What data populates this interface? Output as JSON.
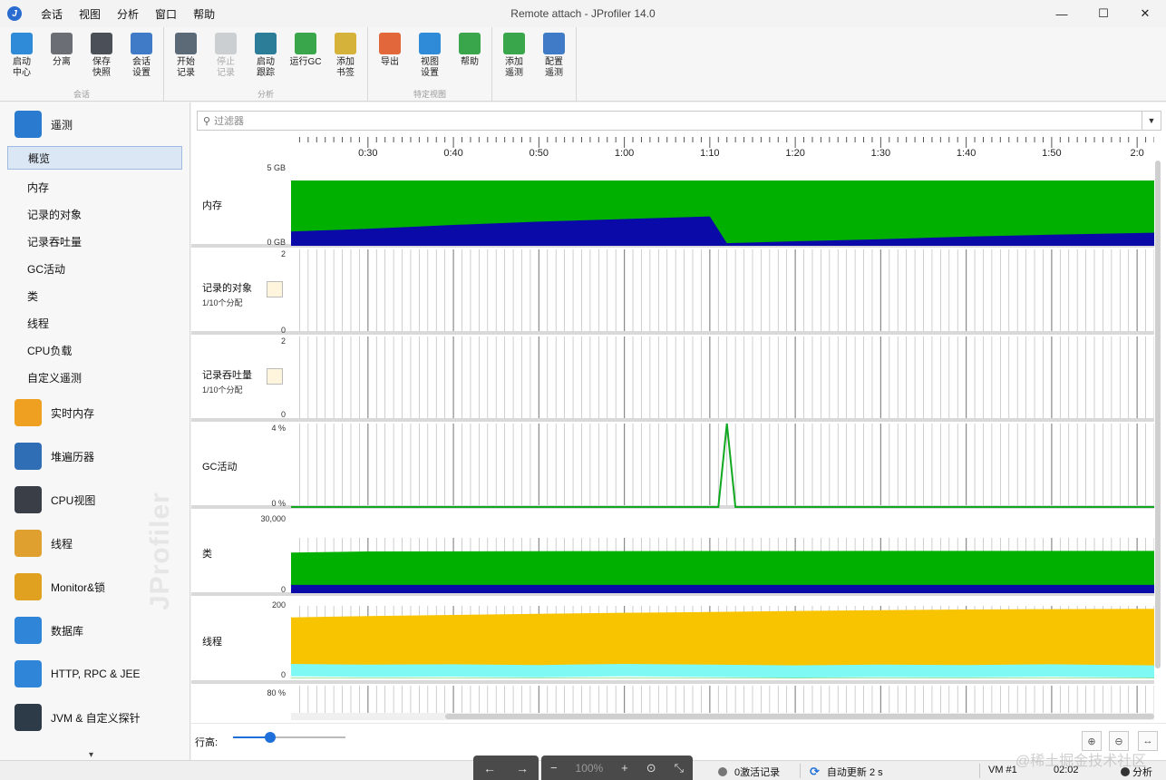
{
  "window": {
    "title": "Remote attach - JProfiler 14.0",
    "app_icon_glyph": "J",
    "minimize_glyph": "—",
    "maximize_glyph": "☐",
    "close_glyph": "✕"
  },
  "menu": [
    "会话",
    "视图",
    "分析",
    "窗口",
    "帮助"
  ],
  "toolbar": {
    "groups": [
      {
        "name": "会话",
        "buttons": [
          {
            "label": "启动\n中心",
            "icon": "start-center-icon",
            "color": "#2f8ad8"
          },
          {
            "label": "分离",
            "icon": "detach-icon",
            "color": "#6b6f75"
          },
          {
            "label": "保存\n快照",
            "icon": "save-snapshot-icon",
            "color": "#4a4f58"
          },
          {
            "label": "会话\n设置",
            "icon": "session-settings-icon",
            "color": "#3f7bc7"
          }
        ]
      },
      {
        "name": "分析",
        "buttons": [
          {
            "label": "开始\n记录",
            "icon": "start-recording-icon",
            "color": "#5c6a78"
          },
          {
            "label": "停止\n记录",
            "icon": "stop-recording-icon",
            "color": "#9aa0a6",
            "disabled": true
          },
          {
            "label": "启动\n跟踪",
            "icon": "start-tracking-icon",
            "color": "#2c7d97"
          },
          {
            "label": "运行GC",
            "icon": "run-gc-icon",
            "color": "#3aa64b"
          },
          {
            "label": "添加\n书签",
            "icon": "add-bookmark-icon",
            "color": "#d5b23a"
          }
        ]
      },
      {
        "name": "特定视图",
        "buttons": [
          {
            "label": "导出",
            "icon": "export-icon",
            "color": "#e2673a"
          },
          {
            "label": "视图\n设置",
            "icon": "view-settings-icon",
            "color": "#2f8ad8"
          },
          {
            "label": "帮助",
            "icon": "help-icon",
            "color": "#3aa64b"
          }
        ]
      },
      {
        "name": "",
        "buttons": [
          {
            "label": "添加\n遥测",
            "icon": "add-telemetry-icon",
            "color": "#3aa64b"
          },
          {
            "label": "配置\n遥测",
            "icon": "configure-telemetry-icon",
            "color": "#3f7bc7"
          }
        ]
      }
    ]
  },
  "sidebar": {
    "telemetry_section": {
      "label": "遥测",
      "icon": "telemetry-icon",
      "color": "#2a7bd0"
    },
    "telemetry_items": [
      "概览",
      "内存",
      "记录的对象",
      "记录吞吐量",
      "GC活动",
      "类",
      "线程",
      "CPU负载",
      "自定义遥测"
    ],
    "active_item": "概览",
    "sections": [
      {
        "label": "实时内存",
        "icon": "live-memory-icon",
        "color": "#f0a020"
      },
      {
        "label": "堆遍历器",
        "icon": "heap-walker-icon",
        "color": "#2f6db5"
      },
      {
        "label": "CPU视图",
        "icon": "cpu-views-icon",
        "color": "#3a3f47"
      },
      {
        "label": "线程",
        "icon": "threads-icon",
        "color": "#e0a030"
      },
      {
        "label": "Monitor&锁",
        "icon": "monitor-lock-icon",
        "color": "#e0a020"
      },
      {
        "label": "数据库",
        "icon": "database-icon",
        "color": "#2f86d8"
      },
      {
        "label": "HTTP, RPC & JEE",
        "icon": "globe-icon",
        "color": "#2f86d8"
      },
      {
        "label": "JVM & 自定义探针",
        "icon": "probe-gauge-icon",
        "color": "#2d3a48"
      }
    ],
    "watermark": "JProfiler",
    "scroll_more_glyph": "▾"
  },
  "filter": {
    "placeholder": "过滤器",
    "search_glyph": "⚲",
    "dropdown_glyph": "▼"
  },
  "timeline": {
    "ticks": [
      "0:30",
      "0:40",
      "0:50",
      "1:00",
      "1:10",
      "1:20",
      "1:30",
      "1:40",
      "1:50",
      "2:0"
    ]
  },
  "rows": [
    {
      "id": "memory",
      "label": "内存",
      "ymax": "5 GB",
      "ymin": "0 GB"
    },
    {
      "id": "recorded-objects",
      "label": "记录的对象",
      "sublabel": "1/10个分配",
      "ymax": "2",
      "ymin": "0"
    },
    {
      "id": "recording-throughput",
      "label": "记录吞吐量",
      "sublabel": "1/10个分配",
      "ymax": "2",
      "ymin": "0"
    },
    {
      "id": "gc-activity",
      "label": "GC活动",
      "ymax": "4 %",
      "ymin": "0 %"
    },
    {
      "id": "classes",
      "label": "类",
      "ymax": "30,000",
      "ymin": "0"
    },
    {
      "id": "threads",
      "label": "线程",
      "ymax": "200",
      "ymin": "0"
    },
    {
      "id": "cpu-load",
      "label": "",
      "ymax": "80 %",
      "ymin": ""
    }
  ],
  "colors": {
    "memory_free": "#00b000",
    "memory_used": "#0a0aa8",
    "gc_line": "#10a820",
    "classes_total": "#00b000",
    "classes_base": "#0a0aa8",
    "threads_total": "#f8c400",
    "threads_runnable": "#7ff9f4",
    "threads_green": "#00b000",
    "grid": "#b9b9b9"
  },
  "chart_data": [
    {
      "type": "area",
      "title": "内存",
      "ylim": [
        0,
        5
      ],
      "unit": "GB",
      "x": [
        "0:21",
        "0:30",
        "0:40",
        "0:50",
        "1:00",
        "1:10",
        "1:12",
        "1:20",
        "1:30",
        "1:40",
        "1:50",
        "2:02"
      ],
      "series": [
        {
          "name": "free",
          "values": [
            5,
            5,
            5,
            5,
            5,
            5,
            5,
            5,
            5,
            5,
            5,
            5
          ]
        },
        {
          "name": "used",
          "values": [
            1.1,
            1.3,
            1.6,
            1.85,
            2.05,
            2.25,
            0.2,
            0.35,
            0.5,
            0.7,
            0.85,
            1.0
          ]
        }
      ]
    },
    {
      "type": "line",
      "title": "GC活动",
      "ylim": [
        0,
        4
      ],
      "unit": "%",
      "x": [
        "0:21",
        "1:11",
        "1:12",
        "1:13",
        "2:02"
      ],
      "values": [
        0,
        0,
        4,
        0,
        0
      ]
    },
    {
      "type": "area",
      "title": "类",
      "ylim": [
        0,
        30000
      ],
      "x": [
        "0:21",
        "0:30",
        "1:00",
        "1:30",
        "2:02"
      ],
      "series": [
        {
          "name": "total",
          "values": [
            22000,
            22600,
            22800,
            22900,
            22900
          ]
        },
        {
          "name": "base",
          "values": [
            4500,
            4500,
            4500,
            4500,
            4500
          ]
        }
      ]
    },
    {
      "type": "area",
      "title": "线程",
      "ylim": [
        0,
        200
      ],
      "x": [
        "0:21",
        "0:30",
        "0:40",
        "0:50",
        "1:00",
        "1:10",
        "1:20",
        "1:30",
        "1:40",
        "1:50",
        "2:02"
      ],
      "series": [
        {
          "name": "total",
          "values": [
            168,
            172,
            175,
            178,
            181,
            183,
            186,
            188,
            190,
            191,
            192
          ]
        },
        {
          "name": "runnable",
          "values": [
            40,
            38,
            39,
            37,
            40,
            38,
            36,
            38,
            37,
            39,
            36
          ]
        }
      ]
    }
  ],
  "bottom": {
    "row_height_label": "行高:",
    "row_height_value": 0.33,
    "zoom_in_glyph": "⊕",
    "zoom_out_glyph": "⊖",
    "fit_glyph": "↔"
  },
  "statusbar": {
    "back_glyph": "←",
    "forward_glyph": "→",
    "zoom_minus": "−",
    "zoom_pct": "100%",
    "zoom_plus": "+",
    "zoom_down": "⊙",
    "collapse_glyph": "⤡",
    "active_recordings": "0激活记录",
    "auto_update": "自动更新 2 s",
    "vm": "VM #1",
    "elapsed": "02:02",
    "analysis": "分析",
    "sync_glyph": "⟳",
    "watermark_text": "@稀土掘金技术社区"
  }
}
